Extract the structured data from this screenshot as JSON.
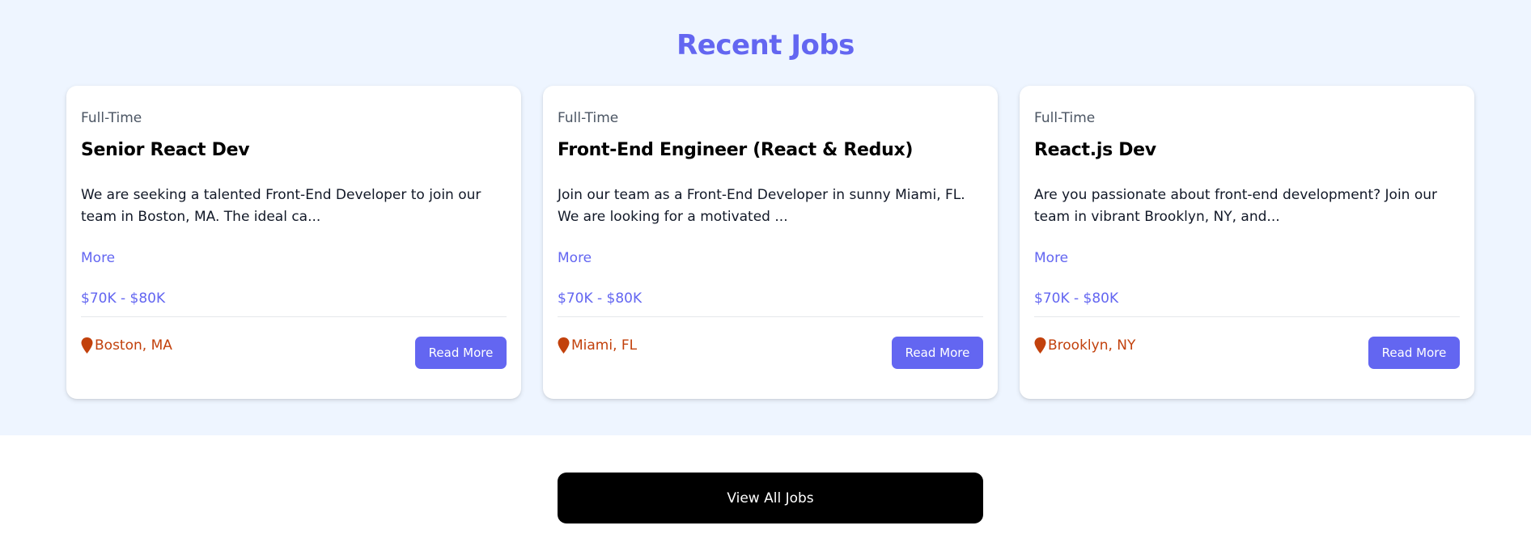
{
  "section": {
    "title": "Recent Jobs"
  },
  "jobs": [
    {
      "type": "Full-Time",
      "title": "Senior React Dev",
      "description": "We are seeking a talented Front-End Developer to join our team in Boston, MA. The ideal ca...",
      "more_label": "More",
      "salary": "$70K - $80K",
      "location": "Boston, MA",
      "button_label": "Read More"
    },
    {
      "type": "Full-Time",
      "title": "Front-End Engineer (React & Redux)",
      "description": "Join our team as a Front-End Developer in sunny Miami, FL. We are looking for a motivated ...",
      "more_label": "More",
      "salary": "$70K - $80K",
      "location": "Miami, FL",
      "button_label": "Read More"
    },
    {
      "type": "Full-Time",
      "title": "React.js Dev",
      "description": "Are you passionate about front-end development? Join our team in vibrant Brooklyn, NY, and...",
      "more_label": "More",
      "salary": "$70K - $80K",
      "location": "Brooklyn, NY",
      "button_label": "Read More"
    }
  ],
  "view_all": {
    "label": "View All Jobs"
  },
  "icons": {
    "location": "map-pin-icon"
  },
  "colors": {
    "accent": "#6366f1",
    "location": "#c2410c",
    "section_background": "#eef5ff",
    "view_all_background": "#000000"
  }
}
